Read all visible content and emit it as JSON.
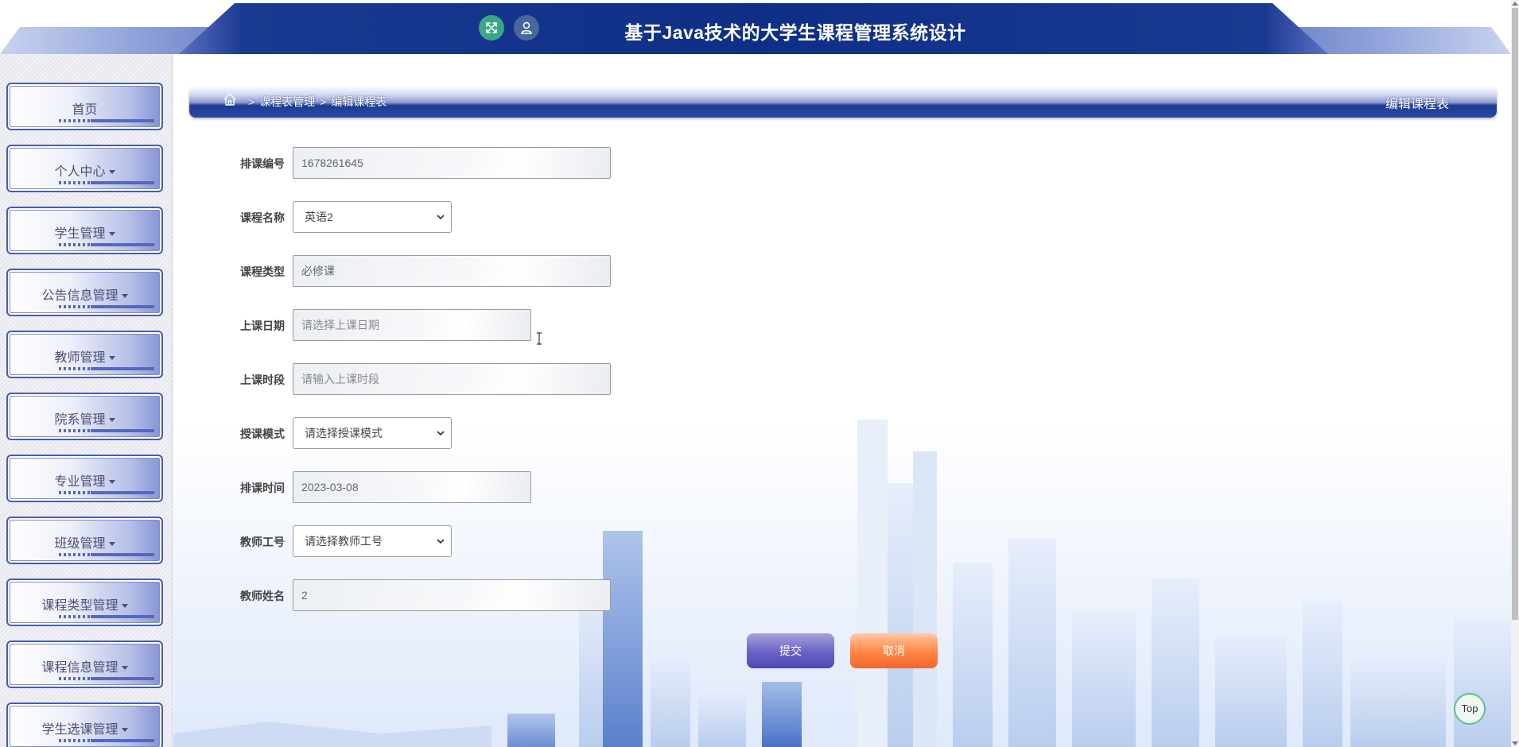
{
  "header": {
    "title": "基于Java技术的大学生课程管理系统设计",
    "icons": [
      "expand-icon",
      "user-icon"
    ]
  },
  "sidebar": {
    "items": [
      {
        "label": "首页",
        "has_caret": false
      },
      {
        "label": "个人中心",
        "has_caret": true
      },
      {
        "label": "学生管理",
        "has_caret": true
      },
      {
        "label": "公告信息管理",
        "has_caret": true
      },
      {
        "label": "教师管理",
        "has_caret": true
      },
      {
        "label": "院系管理",
        "has_caret": true
      },
      {
        "label": "专业管理",
        "has_caret": true
      },
      {
        "label": "班级管理",
        "has_caret": true
      },
      {
        "label": "课程类型管理",
        "has_caret": true
      },
      {
        "label": "课程信息管理",
        "has_caret": true
      },
      {
        "label": "学生选课管理",
        "has_caret": true
      }
    ]
  },
  "breadcrumb": {
    "items": [
      "课程表管理",
      "编辑课程表"
    ],
    "separator": ">",
    "page_heading": "编辑课程表"
  },
  "form": {
    "fields": [
      {
        "label": "排课编号",
        "type": "text",
        "value": "1678261645",
        "placeholder": ""
      },
      {
        "label": "课程名称",
        "type": "select",
        "value": "英语2"
      },
      {
        "label": "课程类型",
        "type": "text",
        "value": "必修课",
        "placeholder": ""
      },
      {
        "label": "上课日期",
        "type": "text",
        "value": "",
        "placeholder": "请选择上课日期"
      },
      {
        "label": "上课时段",
        "type": "text",
        "value": "",
        "placeholder": "请输入上课时段"
      },
      {
        "label": "授课模式",
        "type": "select",
        "value": "请选择授课模式"
      },
      {
        "label": "排课时间",
        "type": "text",
        "value": "2023-03-08",
        "placeholder": ""
      },
      {
        "label": "教师工号",
        "type": "select",
        "value": "请选择教师工号"
      },
      {
        "label": "教师姓名",
        "type": "text",
        "value": "2",
        "placeholder": ""
      }
    ],
    "submit_label": "提交",
    "cancel_label": "取消"
  },
  "top_button_label": "Top",
  "colors": {
    "header_bar": "#0f2f86",
    "submit": "#6d66c6",
    "cancel": "#ff8a4a",
    "top_border": "#5fbf8f",
    "expand_icon_bg": "#3aa686",
    "user_icon_bg": "#47689a"
  }
}
